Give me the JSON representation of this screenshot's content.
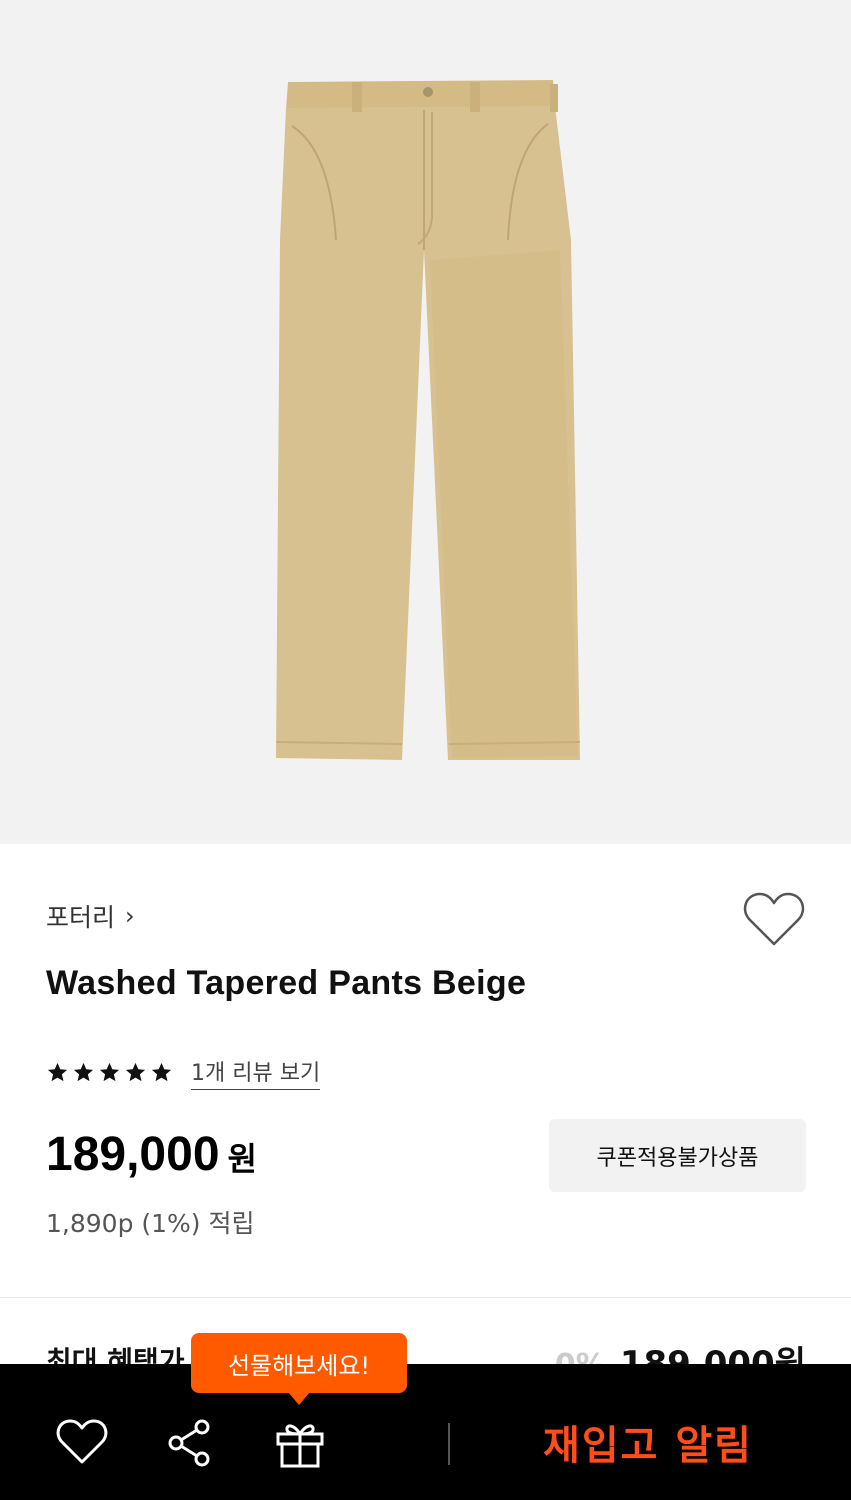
{
  "product": {
    "brand": "포터리",
    "brand_chevron": "›",
    "title": "Washed Tapered Pants Beige",
    "rating_stars": 5,
    "review_link": "1개 리뷰 보기",
    "price": "189,000",
    "currency": "원",
    "coupon_badge": "쿠폰적용불가상품",
    "points": "1,890p (1%) 적립"
  },
  "benefit": {
    "label": "최대 혜택가",
    "discount": "0%",
    "price": "189,000원"
  },
  "bottom_bar": {
    "wish_icon": "heart-icon",
    "share_icon": "share-icon",
    "gift_icon": "gift-icon",
    "restock_label": "재입고 알림",
    "gift_tooltip": "선물해보세요!"
  },
  "colors": {
    "accent": "#ff5a00",
    "restock_text": "#ff4e1a",
    "image_bg": "#f2f2f2",
    "pants": "#d9c18e"
  }
}
